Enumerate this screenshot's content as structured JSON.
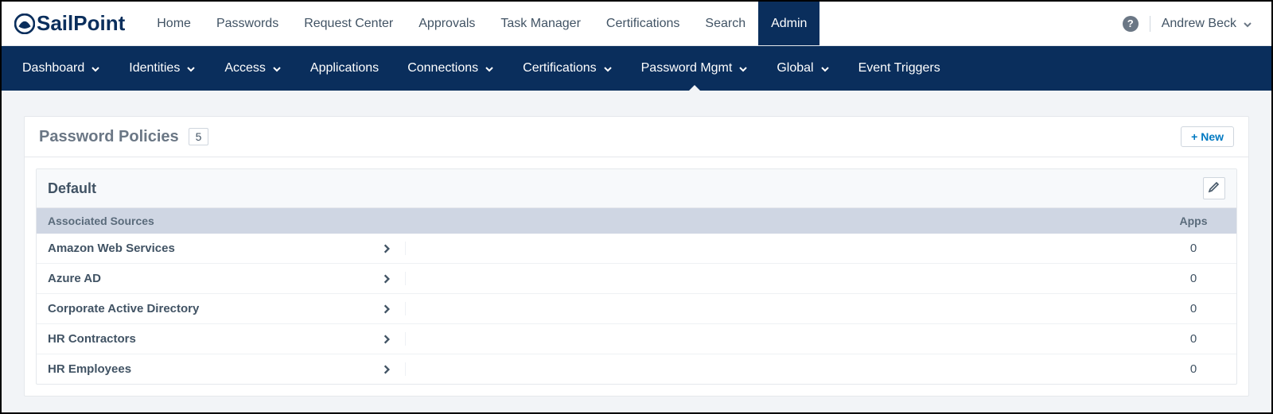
{
  "brand": "SailPoint",
  "topnav": {
    "items": [
      {
        "label": "Home"
      },
      {
        "label": "Passwords"
      },
      {
        "label": "Request Center"
      },
      {
        "label": "Approvals"
      },
      {
        "label": "Task Manager"
      },
      {
        "label": "Certifications"
      },
      {
        "label": "Search"
      },
      {
        "label": "Admin"
      }
    ],
    "active_index": 7,
    "user": "Andrew Beck"
  },
  "subnav": {
    "items": [
      {
        "label": "Dashboard",
        "dropdown": true
      },
      {
        "label": "Identities",
        "dropdown": true
      },
      {
        "label": "Access",
        "dropdown": true
      },
      {
        "label": "Applications",
        "dropdown": false
      },
      {
        "label": "Connections",
        "dropdown": true
      },
      {
        "label": "Certifications",
        "dropdown": true
      },
      {
        "label": "Password Mgmt",
        "dropdown": true
      },
      {
        "label": "Global",
        "dropdown": true
      },
      {
        "label": "Event Triggers",
        "dropdown": false
      }
    ],
    "active_index": 6
  },
  "page": {
    "title": "Password Policies",
    "count": "5",
    "new_button": "+ New",
    "card": {
      "title": "Default",
      "columns": {
        "sources": "Associated Sources",
        "apps": "Apps"
      },
      "rows": [
        {
          "source": "Amazon Web Services",
          "apps": "0"
        },
        {
          "source": "Azure AD",
          "apps": "0"
        },
        {
          "source": "Corporate Active Directory",
          "apps": "0"
        },
        {
          "source": "HR Contractors",
          "apps": "0"
        },
        {
          "source": "HR Employees",
          "apps": "0"
        }
      ]
    }
  }
}
